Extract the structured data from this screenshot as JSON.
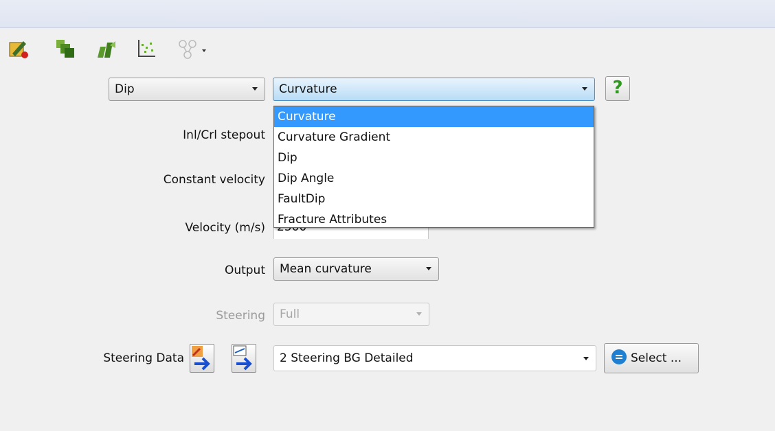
{
  "toolbar": {
    "icons": [
      "attribute-set-icon",
      "volume-icon",
      "multi-volume-icon",
      "crossplot-icon",
      "tree-dropdown-icon"
    ]
  },
  "attr_group": {
    "value": "Dip"
  },
  "attr_type": {
    "value": "Curvature",
    "options": [
      "Curvature",
      "Curvature Gradient",
      "Dip",
      "Dip Angle",
      "FaultDip",
      "Fracture Attributes"
    ]
  },
  "help": {
    "label": "?"
  },
  "form": {
    "stepout_label": "Inl/Crl stepout",
    "constant_velocity_label": "Constant velocity",
    "velocity_label": "Velocity (m/s)",
    "velocity_value": "2500",
    "output_label": "Output",
    "output_value": "Mean curvature",
    "steering_label": "Steering",
    "steering_value": "Full",
    "steering_data_label": "Steering Data",
    "steering_data_value": "2 Steering BG Detailed",
    "select_label": "Select ..."
  }
}
